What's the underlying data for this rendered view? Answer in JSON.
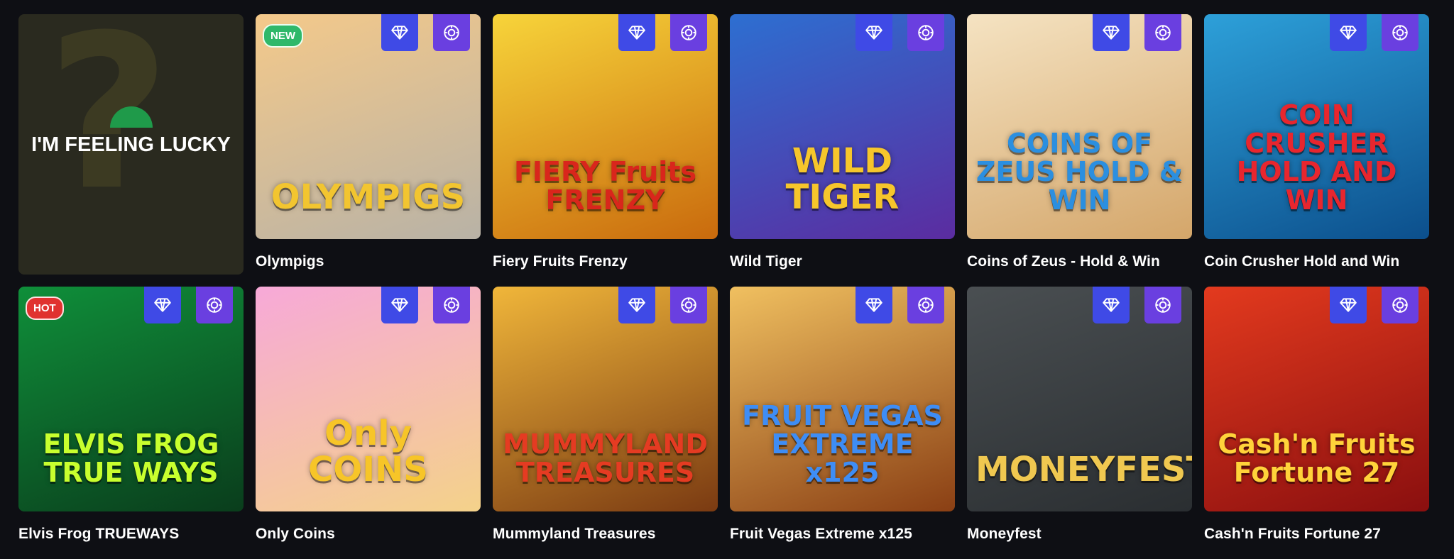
{
  "lucky": {
    "label": "I'M FEELING LUCKY"
  },
  "games": [
    {
      "name": "Olympigs",
      "art_title": "OLYMPIGS",
      "tag": "NEW",
      "bg_from": "#f4c98a",
      "bg_to": "#b8b2a6",
      "title_color": "#f2c530"
    },
    {
      "name": "Fiery Fruits Frenzy",
      "art_title": "FIERY Fruits FRENZY",
      "tag": "",
      "bg_from": "#f7d43a",
      "bg_to": "#c96a0d",
      "title_color": "#d9261c"
    },
    {
      "name": "Wild Tiger",
      "art_title": "WILD TIGER",
      "tag": "",
      "bg_from": "#2d6fd1",
      "bg_to": "#5b2ca0",
      "title_color": "#f6c62b"
    },
    {
      "name": "Coins of Zeus - Hold & Win",
      "art_title": "COINS OF ZEUS HOLD & WIN",
      "tag": "",
      "bg_from": "#f5e3c2",
      "bg_to": "#d4a66a",
      "title_color": "#2b8fe0"
    },
    {
      "name": "Coin Crusher Hold and Win",
      "art_title": "COIN CRUSHER HOLD AND WIN",
      "tag": "",
      "bg_from": "#2da0d9",
      "bg_to": "#0c4f8c",
      "title_color": "#e8262e"
    },
    {
      "name": "Elvis Frog TRUEWAYS",
      "art_title": "ELVIS FROG TRUE WAYS",
      "tag": "HOT",
      "bg_from": "#0f8f3a",
      "bg_to": "#0a3d1c",
      "title_color": "#c8ff2e"
    },
    {
      "name": "Only Coins",
      "art_title": "Only COINS",
      "tag": "",
      "bg_from": "#f7a9d8",
      "bg_to": "#f4d28a",
      "title_color": "#f7c528"
    },
    {
      "name": "Mummyland Treasures",
      "art_title": "MUMMYLAND TREASURES",
      "tag": "",
      "bg_from": "#f0b63a",
      "bg_to": "#7a3a12",
      "title_color": "#e53b22"
    },
    {
      "name": "Fruit Vegas Extreme x125",
      "art_title": "FRUIT VEGAS EXTREME x125",
      "tag": "",
      "bg_from": "#f0c060",
      "bg_to": "#8a3f14",
      "title_color": "#3e8df5"
    },
    {
      "name": "Moneyfest",
      "art_title": "MONEYFEST",
      "tag": "",
      "bg_from": "#4a4f52",
      "bg_to": "#2a2e31",
      "title_color": "#f0c850"
    },
    {
      "name": "Cash'n Fruits Fortune 27",
      "art_title": "Cash'n Fruits Fortune 27",
      "tag": "",
      "bg_from": "#e33a1e",
      "bg_to": "#8a0f0f",
      "title_color": "#ffd33a"
    }
  ],
  "badge_icons": {
    "gem": "diamond-icon",
    "chip": "casino-chip-icon"
  }
}
